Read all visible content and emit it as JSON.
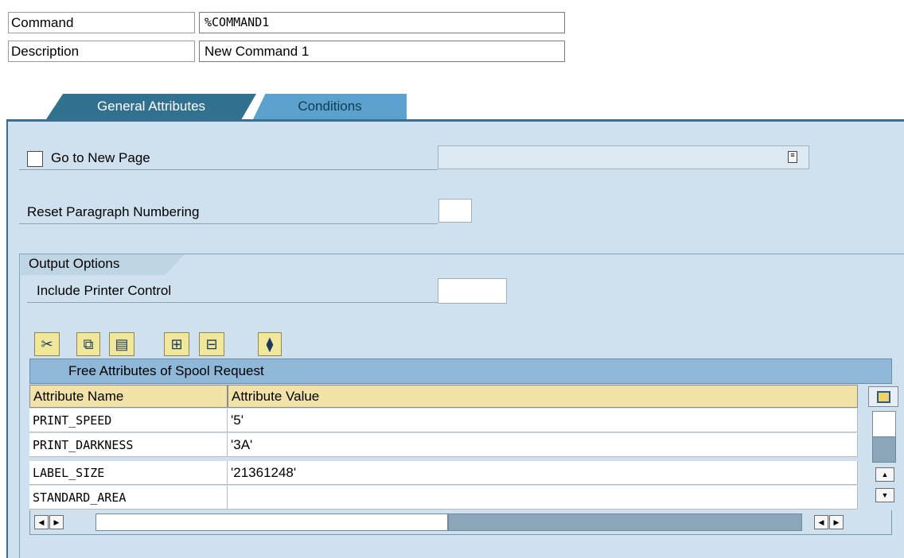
{
  "header": {
    "command_label": "Command",
    "command_value": "%COMMAND1",
    "description_label": "Description",
    "description_value": "New Command 1"
  },
  "tabs": [
    {
      "label": "General Attributes",
      "active": true
    },
    {
      "label": "Conditions",
      "active": false
    }
  ],
  "general": {
    "new_page_label": "Go to New Page",
    "new_page_checked": false,
    "new_page_select_value": "",
    "reset_numbering_label": "Reset Paragraph Numbering",
    "reset_numbering_value": ""
  },
  "output_options": {
    "title": "Output Options",
    "printer_control_label": "Include Printer Control",
    "printer_control_value": ""
  },
  "toolbar": {
    "icons": [
      "cut-icon",
      "copy-icon",
      "paste-icon",
      "insert-row-icon",
      "delete-row-icon",
      "details-icon"
    ]
  },
  "table": {
    "title": "Free Attributes of Spool Request",
    "columns": [
      "Attribute Name",
      "Attribute Value"
    ],
    "rows": [
      {
        "name": "PRINT_SPEED",
        "value": "'5'"
      },
      {
        "name": "PRINT_DARKNESS",
        "value": "'3A'"
      },
      {
        "name": "LABEL_SIZE",
        "value": "'21361248'"
      },
      {
        "name": "STANDARD_AREA",
        "value": ""
      }
    ]
  },
  "colors": {
    "panel_bg": "#cfe1ee",
    "tab_active": "#31708f",
    "tab_inactive": "#5aa2cd",
    "table_header": "#f3e2a8",
    "toolbar_button": "#f1e79a"
  }
}
